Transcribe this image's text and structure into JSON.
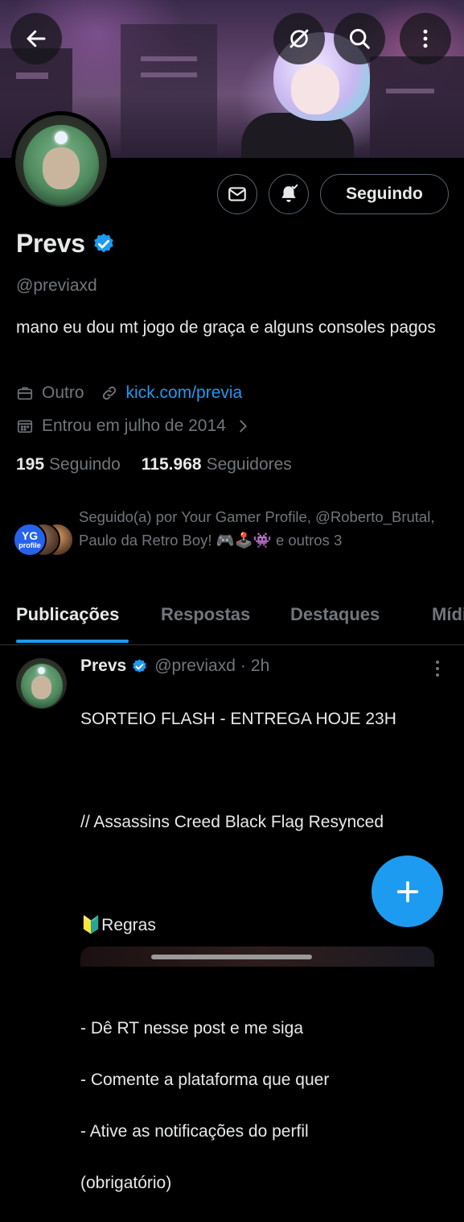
{
  "header": {
    "back_icon": "arrow-left-icon",
    "grok_icon": "grok-icon",
    "search_icon": "search-icon",
    "more_icon": "more-vertical-icon"
  },
  "profile": {
    "name": "Prevs",
    "handle": "@previaxd",
    "bio": "mano eu dou mt jogo de graça e alguns consoles pagos",
    "category": "Outro",
    "website": "kick.com/previa",
    "joined": "Entrou em julho de 2014",
    "following_count": "195",
    "following_label": "Seguindo",
    "followers_count": "115.968",
    "followers_label": "Seguidores",
    "followed_by": "Seguido(a) por Your Gamer Profile, @Roberto_Brutal, Paulo da Retro Boy! 🎮🕹️👾 e outros 3",
    "followed_by_avatar_text": "profile"
  },
  "actions": {
    "message_icon": "mail-icon",
    "notify_icon": "bell-check-icon",
    "following_button": "Seguindo"
  },
  "tabs": [
    {
      "label": "Publicações",
      "active": true
    },
    {
      "label": "Respostas",
      "active": false
    },
    {
      "label": "Destaques",
      "active": false
    },
    {
      "label": "Mídia",
      "active": false
    }
  ],
  "post": {
    "author": "Prevs",
    "handle": "@previaxd",
    "separator": "·",
    "time": "2h",
    "line1": "SORTEIO FLASH - ENTREGA HOJE 23H",
    "line2": "// Assassins Creed Black Flag Resynced",
    "line3": "🔰Regras",
    "line4": "- Dê RT nesse post e me siga",
    "line5": "- Comente a plataforma que quer",
    "line6": "- Ative as notificações do perfil",
    "line7": "(obrigatório)"
  },
  "colors": {
    "accent": "#1d9bf0",
    "background": "#000000",
    "text": "#e7e9ea",
    "muted": "#71767b"
  }
}
